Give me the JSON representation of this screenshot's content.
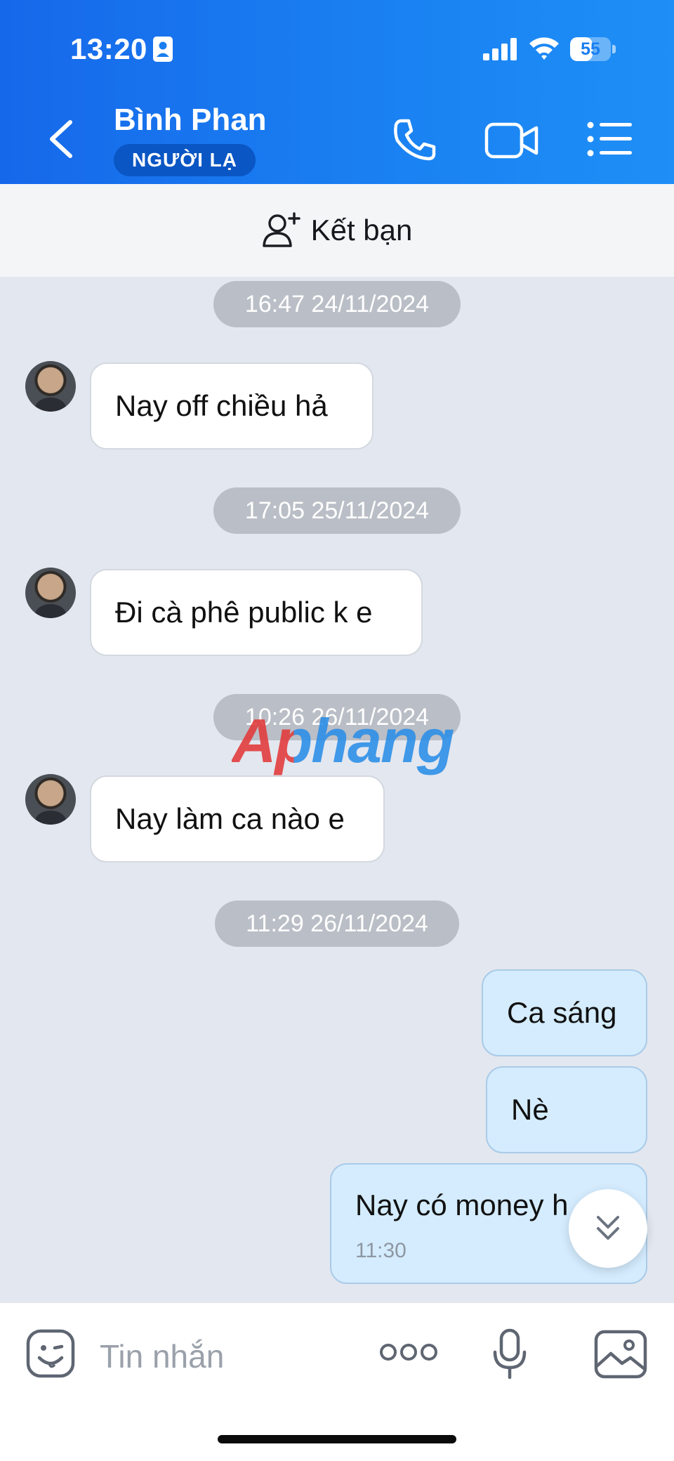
{
  "status_bar": {
    "time": "13:20",
    "battery": "55",
    "battery_level": 0.55
  },
  "header": {
    "contact_name": "Bình Phan",
    "badge": "NGƯỜI LẠ"
  },
  "friend_bar": {
    "label": "Kết bạn"
  },
  "messages": [
    {
      "type": "timestamp",
      "text": "16:47 24/11/2024"
    },
    {
      "type": "incoming",
      "text": "Nay off chiều hả"
    },
    {
      "type": "timestamp",
      "text": "17:05 25/11/2024"
    },
    {
      "type": "incoming",
      "text": "Đi cà phê public k e"
    },
    {
      "type": "timestamp",
      "text": "10:26 26/11/2024"
    },
    {
      "type": "incoming",
      "text": "Nay làm ca nào e"
    },
    {
      "type": "timestamp",
      "text": "11:29 26/11/2024"
    },
    {
      "type": "outgoing",
      "text": "Ca sáng"
    },
    {
      "type": "outgoing",
      "text": "Nè"
    },
    {
      "type": "outgoing",
      "text": "Nay có money h",
      "time": "11:30"
    }
  ],
  "watermark": "Aphang",
  "composer": {
    "placeholder": "Tin nhắn"
  },
  "colors": {
    "header": "#1a7ef0",
    "outgoing_bubble": "#d4ecfe",
    "chat_bg": "#e3e7ef"
  }
}
